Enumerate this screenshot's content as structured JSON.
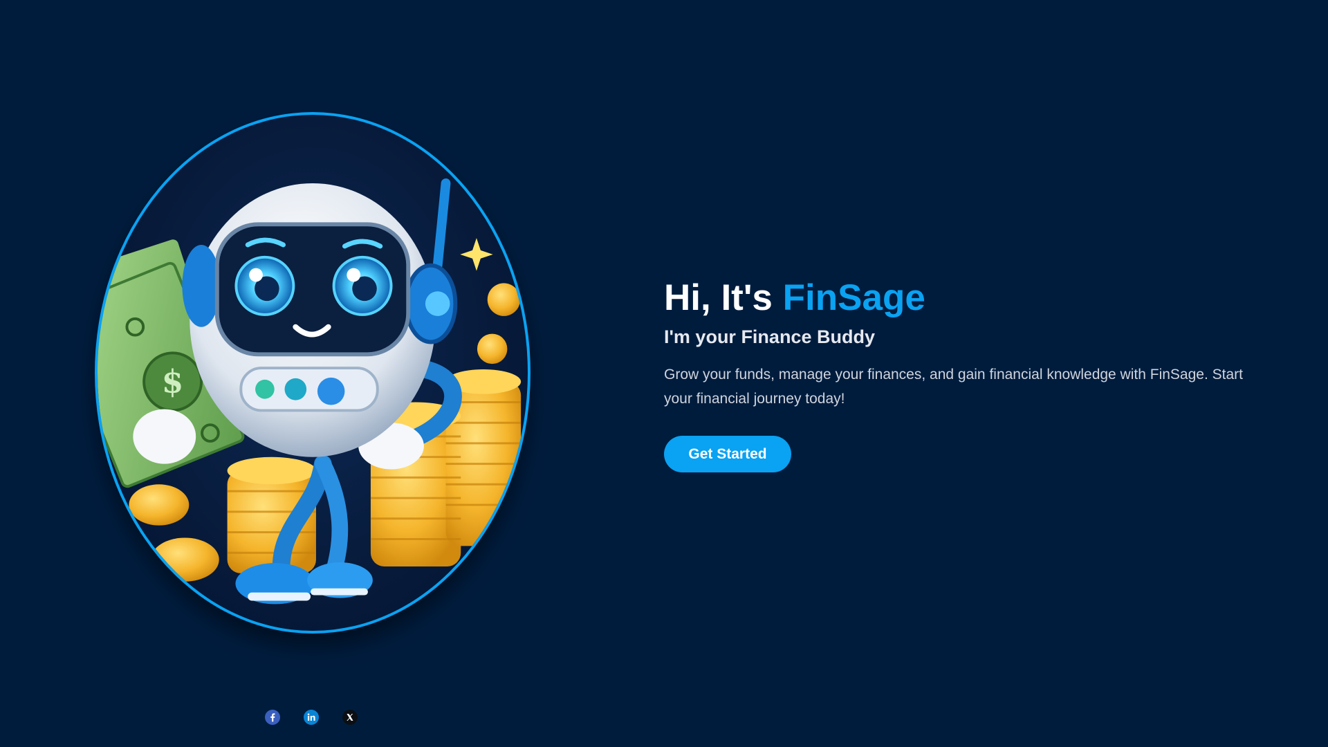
{
  "hero": {
    "headline_prefix": "Hi, It's ",
    "brand_name": "FinSage",
    "subheadline": "I'm your Finance Buddy",
    "description": "Grow your funds, manage your finances, and gain financial knowledge with FinSage. Start your financial journey today!",
    "cta_label": "Get Started"
  },
  "social": {
    "icons": [
      "facebook-icon",
      "linkedin-icon",
      "x-icon"
    ]
  },
  "colors": {
    "background": "#001c3d",
    "accent": "#0aa2f2",
    "text": "#ffffff"
  }
}
